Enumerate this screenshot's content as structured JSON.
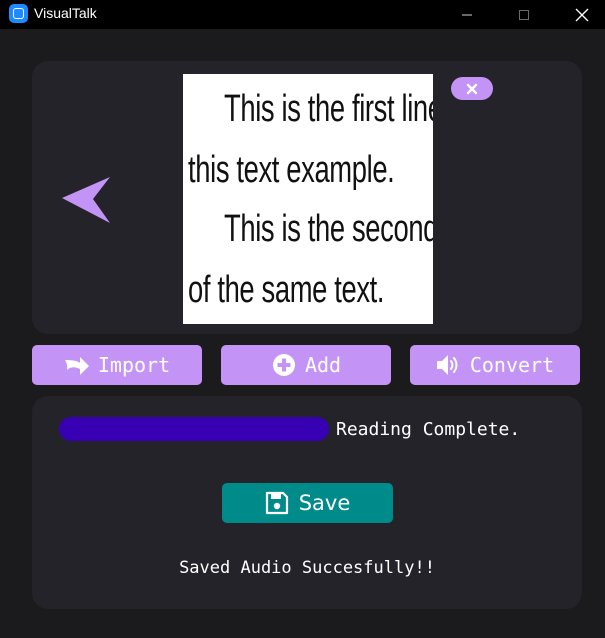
{
  "window": {
    "title": "VisualTalk",
    "icon": "app-icon",
    "controls": [
      "minimize-icon",
      "maximize-icon",
      "close-icon"
    ]
  },
  "preview": {
    "lines": [
      "This is the first line of",
      "this text example.",
      "This is the second line",
      "of the same text."
    ],
    "remove_icon": "close-icon",
    "back_icon": "arrow-left-icon"
  },
  "actions": {
    "import": {
      "label": "Import",
      "icon": "share-arrow-icon"
    },
    "add": {
      "label": "Add",
      "icon": "plus-circle-icon"
    },
    "convert": {
      "label": "Convert",
      "icon": "speaker-icon"
    }
  },
  "progress": {
    "value": 1.0,
    "status": "Reading Complete."
  },
  "save": {
    "label": "Save",
    "icon": "floppy-disk-icon"
  },
  "message": "Saved Audio Succesfully!!",
  "colors": {
    "background": "#1b1a1d",
    "panel": "#25232a",
    "accent": "#c394f5",
    "save": "#008b8b",
    "progress": "#3700b3",
    "titlebar": "#000000"
  }
}
